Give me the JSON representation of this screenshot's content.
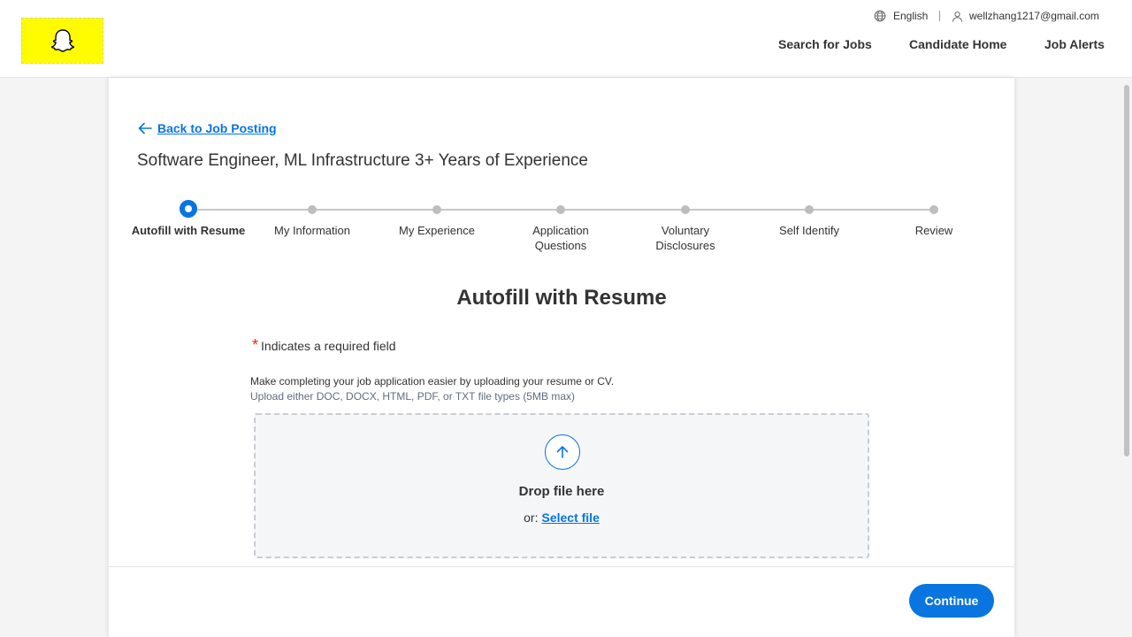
{
  "header": {
    "logo_name": "snapchat-ghost-icon",
    "language": "English",
    "user_email": "wellzhang1217@gmail.com",
    "nav": {
      "search_jobs": "Search for Jobs",
      "candidate_home": "Candidate Home",
      "job_alerts": "Job Alerts"
    }
  },
  "main": {
    "back_link": "Back to Job Posting",
    "job_title": "Software Engineer, ML Infrastructure 3+ Years of Experience",
    "steps": [
      {
        "label": "Autofill with Resume",
        "state": "current"
      },
      {
        "label": "My Information",
        "state": "upcoming"
      },
      {
        "label": "My Experience",
        "state": "upcoming"
      },
      {
        "label": "Application Questions",
        "state": "upcoming"
      },
      {
        "label": "Voluntary Disclosures",
        "state": "upcoming"
      },
      {
        "label": "Self Identify",
        "state": "upcoming"
      },
      {
        "label": "Review",
        "state": "upcoming"
      }
    ],
    "section_title": "Autofill with Resume",
    "required_star": "*",
    "required_note": "Indicates a required field",
    "intro_text": "Make completing your job application easier by uploading your resume or CV.",
    "file_types": "Upload either DOC, DOCX, HTML, PDF, or TXT file types (5MB max)",
    "dropzone": {
      "drop_text": "Drop file here",
      "or_text": "or",
      "select_link": "Select file"
    },
    "continue_label": "Continue"
  },
  "colors": {
    "brand_yellow": "#fffc00",
    "accent_blue": "#0875e1",
    "required_red": "#de2e21"
  }
}
